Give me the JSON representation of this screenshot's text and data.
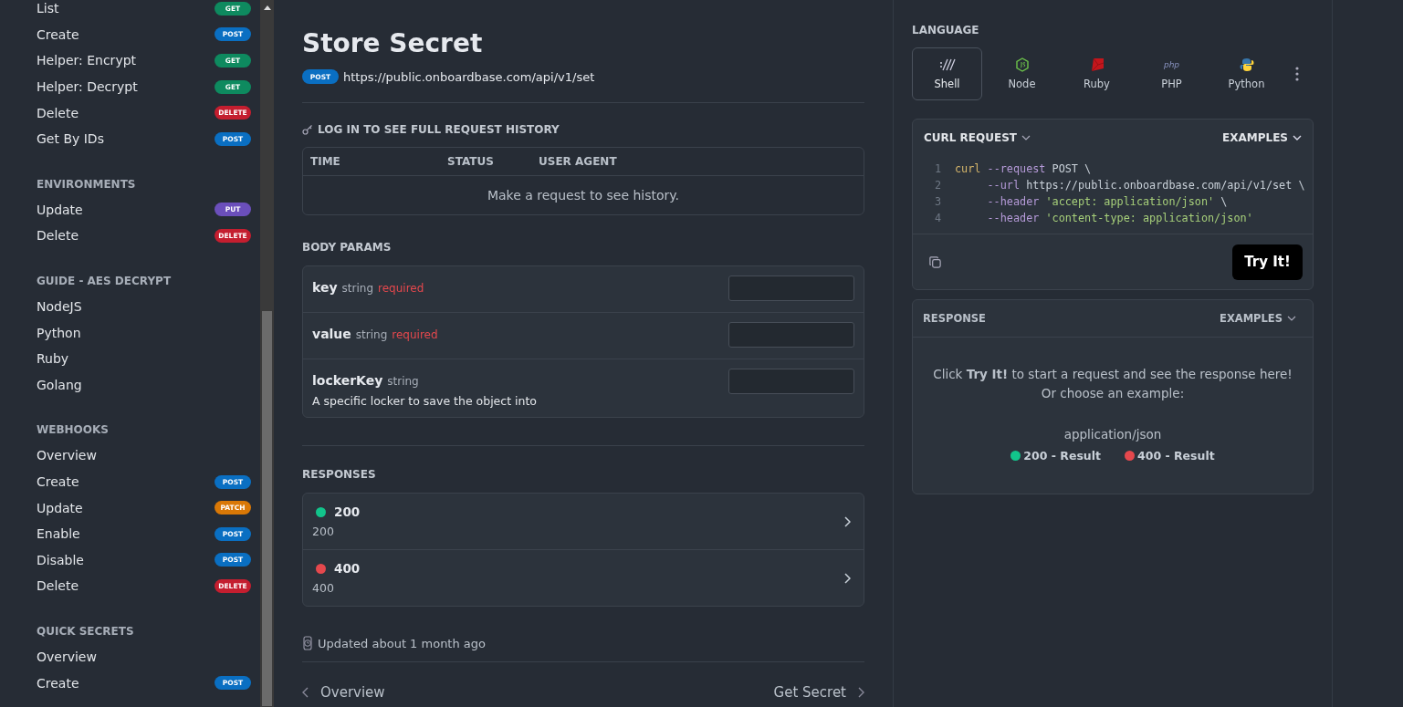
{
  "sidebar": {
    "sections": [
      {
        "items": [
          {
            "label": "List",
            "method": "GET"
          },
          {
            "label": "Create",
            "method": "POST"
          },
          {
            "label": "Helper: Encrypt",
            "method": "GET"
          },
          {
            "label": "Helper: Decrypt",
            "method": "GET"
          },
          {
            "label": "Delete",
            "method": "DELETE"
          },
          {
            "label": "Get By IDs",
            "method": "POST"
          }
        ]
      },
      {
        "title": "ENVIRONMENTS",
        "items": [
          {
            "label": "Update",
            "method": "PUT"
          },
          {
            "label": "Delete",
            "method": "DELETE"
          }
        ]
      },
      {
        "title": "GUIDE - AES DECRYPT",
        "items": [
          {
            "label": "NodeJS"
          },
          {
            "label": "Python"
          },
          {
            "label": "Ruby"
          },
          {
            "label": "Golang"
          }
        ]
      },
      {
        "title": "WEBHOOKS",
        "items": [
          {
            "label": "Overview"
          },
          {
            "label": "Create",
            "method": "POST"
          },
          {
            "label": "Update",
            "method": "PATCH"
          },
          {
            "label": "Enable",
            "method": "POST"
          },
          {
            "label": "Disable",
            "method": "POST"
          },
          {
            "label": "Delete",
            "method": "DELETE"
          }
        ]
      },
      {
        "title": "QUICK SECRETS",
        "items": [
          {
            "label": "Overview"
          },
          {
            "label": "Create",
            "method": "POST"
          }
        ]
      }
    ]
  },
  "page": {
    "title": "Store Secret",
    "method": "POST",
    "url": "https://public.onboardbase.com/api/v1/set"
  },
  "history": {
    "title": "LOG IN TO SEE FULL REQUEST HISTORY",
    "columns": [
      "TIME",
      "STATUS",
      "USER AGENT"
    ],
    "empty": "Make a request to see history."
  },
  "body_params": {
    "title": "BODY PARAMS",
    "params": [
      {
        "name": "key",
        "type": "string",
        "required": "required"
      },
      {
        "name": "value",
        "type": "string",
        "required": "required"
      },
      {
        "name": "lockerKey",
        "type": "string",
        "description": "A specific locker to save the object into"
      }
    ]
  },
  "responses": {
    "title": "RESPONSES",
    "items": [
      {
        "code": "200",
        "description": "200",
        "color": "#12c48b"
      },
      {
        "code": "400",
        "description": "400",
        "color": "#e5484d"
      }
    ]
  },
  "updated": "Updated about 1 month ago",
  "pager": {
    "previous": "Overview",
    "next": "Get Secret"
  },
  "language": {
    "title": "LANGUAGE",
    "options": [
      {
        "label": "Shell",
        "kind": "shell",
        "selected": true
      },
      {
        "label": "Node",
        "kind": "node",
        "selected": false
      },
      {
        "label": "Ruby",
        "kind": "ruby",
        "selected": false
      },
      {
        "label": "PHP",
        "kind": "php",
        "logo_text": "php",
        "selected": false
      },
      {
        "label": "Python",
        "kind": "python",
        "selected": false
      }
    ]
  },
  "request": {
    "title": "CURL REQUEST",
    "examples": "EXAMPLES",
    "lines": [
      {
        "number": "1",
        "tokens": [
          {
            "text": "curl",
            "kind": "command"
          },
          {
            "text": " --request",
            "kind": "flag"
          },
          {
            "text": " POST \\",
            "kind": "plain"
          }
        ]
      },
      {
        "number": "2",
        "tokens": [
          {
            "text": "     --url",
            "kind": "flag"
          },
          {
            "text": " https://public.onboardbase.com/api/v1/set \\",
            "kind": "plain"
          }
        ]
      },
      {
        "number": "3",
        "tokens": [
          {
            "text": "     --header",
            "kind": "flag"
          },
          {
            "text": " 'accept: application/json'",
            "kind": "string"
          },
          {
            "text": " \\",
            "kind": "plain"
          }
        ]
      },
      {
        "number": "4",
        "tokens": [
          {
            "text": "     --header",
            "kind": "flag"
          },
          {
            "text": " 'content-type: application/json'",
            "kind": "string"
          }
        ]
      }
    ],
    "try_button": "Try It!"
  },
  "response": {
    "title": "RESPONSE",
    "examples": "EXAMPLES",
    "message": "Click **Try It!** to start a request and see the response here! Or choose an example:",
    "media_type": "application/json",
    "examples_list": [
      {
        "label": "200 - Result",
        "color": "#12c48b"
      },
      {
        "label": "400 - Result",
        "color": "#e5484d"
      }
    ]
  }
}
